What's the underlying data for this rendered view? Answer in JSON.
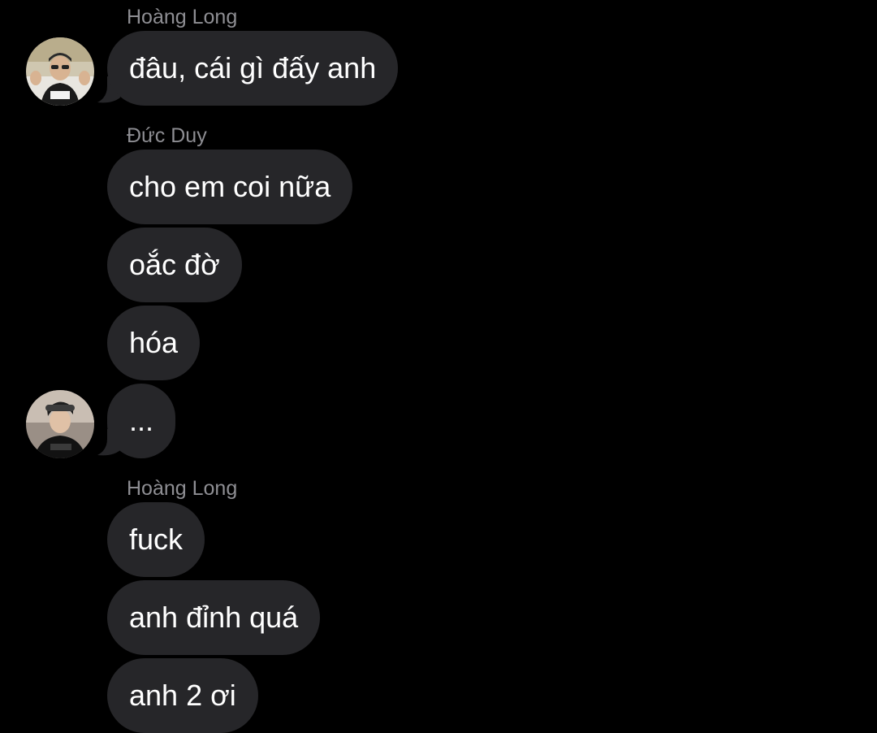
{
  "conversation": {
    "groups": [
      {
        "sender": "Hoàng Long",
        "messages": [
          "đâu, cái gì đấy anh"
        ]
      },
      {
        "sender": "Đức Duy",
        "messages": [
          "cho em coi nữa",
          "oắc đờ",
          "hóa",
          "..."
        ]
      },
      {
        "sender": "Hoàng Long",
        "messages": [
          "fuck",
          "anh đỉnh quá",
          "anh 2 ơi"
        ]
      }
    ]
  },
  "colors": {
    "background": "#000000",
    "bubble": "#262629",
    "bubble_text": "#ffffff",
    "sender_name": "#8e8e93"
  }
}
